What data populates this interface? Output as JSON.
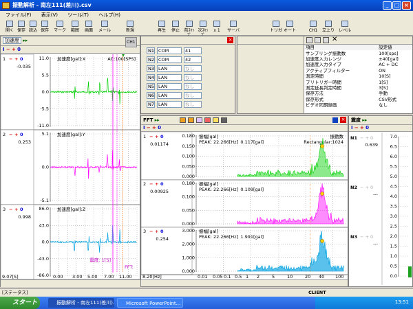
{
  "window": {
    "title": "振動解析 - 南左111(差川).csv"
  },
  "menu": [
    "ファイル(F)",
    "表示(V)",
    "ツール(T)",
    "ヘルプ(H)"
  ],
  "toolbar": [
    "開く",
    "保存",
    "読込",
    "保存",
    "マーク",
    "範囲",
    "画面",
    "メール",
    "新規",
    "再生",
    "停止",
    "前ｽｷｯﾌﾟ",
    "次ｽｷｯﾌﾟ",
    "x 1",
    "サーバ",
    "トリガ",
    "オート",
    "CH1",
    "立上り",
    "レベル"
  ],
  "left_panel": {
    "mode": "加速度",
    "ch_label": "CH1",
    "channels": [
      {
        "index": "1",
        "value": "-0.035",
        "label": "加速度[gal]:X",
        "extra": "AC:100[SPS]",
        "ticks": [
          "11.0",
          "5.5",
          "0.0",
          "-5.5",
          "-11.0"
        ],
        "color": "#00d000"
      },
      {
        "index": "2",
        "value": "0.253",
        "label": "加速度[gal]:Y",
        "extra": "",
        "ticks": [
          "5.1",
          "0.0",
          "-5.1"
        ],
        "color": "#ff00ff"
      },
      {
        "index": "3",
        "value": "0.998",
        "label": "加速度[gal]:Z",
        "extra": "",
        "ticks": [
          "86.0",
          "43.0",
          "0.0",
          "-43.0",
          "-86.0"
        ],
        "color": "#00a0e0"
      }
    ],
    "xticks": [
      "9.07[S]",
      "0.00",
      "3.00",
      "5.00",
      "7.00",
      "11.00"
    ],
    "cursor1": "震度: 1[S]",
    "cursor2": "FFT:"
  },
  "com_panel": {
    "rows": [
      {
        "id": "N1",
        "type": "COM",
        "port": "41"
      },
      {
        "id": "N2",
        "type": "COM",
        "port": "42"
      },
      {
        "id": "N3",
        "type": "LAN",
        "port": "なし"
      },
      {
        "id": "N4",
        "type": "LAN",
        "port": "なし"
      },
      {
        "id": "N5",
        "type": "LAN",
        "port": "なし"
      },
      {
        "id": "N6",
        "type": "LAN",
        "port": "なし"
      },
      {
        "id": "N7",
        "type": "LAN",
        "port": "なし"
      }
    ]
  },
  "settings": {
    "col1": "項目",
    "col2": "設定値",
    "rows": [
      [
        "サンプリング振動数",
        "100[sps]"
      ],
      [
        "加速度入力レンジ",
        "±40[gal]"
      ],
      [
        "加速度入力タイプ",
        "AC + DC"
      ],
      [
        "アクティブフィルター",
        "ON"
      ],
      [
        "測定時間",
        "10[S]"
      ],
      [
        "プリトリガー時間",
        "1[S]"
      ],
      [
        "測定延長判定時間",
        "3[S]"
      ],
      [
        "保存方法",
        "手動"
      ],
      [
        "保存形式",
        "CSV形式"
      ],
      [
        "ビデオ同期録画",
        "なし"
      ]
    ]
  },
  "fft_panel": {
    "title": "FFT",
    "channels": [
      {
        "index": "1",
        "value": "0.01174",
        "label": "振幅[gal]",
        "peak": "PEAK: 22.266[Hz]",
        "amp": "0.117[gal]",
        "extra": "振動数",
        "window": "Rectangular:1024",
        "ticks": [
          "0.180",
          "0.150",
          "0.100",
          "0.050",
          "0.000"
        ],
        "color": "#00d000"
      },
      {
        "index": "2",
        "value": "0.00925",
        "label": "振幅[gal]",
        "peak": "PEAK: 22.266[Hz]",
        "amp": "0.109[gal]",
        "extra": "",
        "window": "",
        "ticks": [
          "0.180",
          "0.100",
          "0.050",
          "0.000"
        ],
        "color": "#ff00ff"
      },
      {
        "index": "3",
        "value": "0.254",
        "label": "振幅[gal]",
        "peak": "PEAK: 22.266[Hz]",
        "amp": "1.991[gal]",
        "extra": "",
        "window": "",
        "ticks": [
          "3.000",
          "2.000",
          "1.000",
          "0.000"
        ],
        "color": "#00a0e0"
      }
    ],
    "xticks": [
      "8.20[Hz]",
      "0.01",
      "0.05",
      "0.1",
      "0.5",
      "1",
      "2",
      "5",
      "10",
      "20",
      "40",
      "100"
    ]
  },
  "intensity_panel": {
    "title": "震度",
    "rows": [
      {
        "id": "N1",
        "value": "0.639"
      },
      {
        "id": "N2",
        "value": "---"
      },
      {
        "id": "N3",
        "value": "---"
      }
    ],
    "ticks": [
      "7.0",
      "6.5",
      "6.0",
      "5.5",
      "5.0",
      "4.5",
      "4.0",
      "3.5",
      "3.0",
      "2.5",
      "2.0",
      "1.5",
      "1.0",
      "0.5",
      "0.0"
    ]
  },
  "statusbar": {
    "text": "[ステータス]",
    "right": "CLIENT"
  },
  "taskbar": {
    "start": "スタート",
    "tasks": [
      "振動解析 - 南左111(差川)...",
      "Microsoft PowerPoint..."
    ],
    "time": "13:51"
  }
}
